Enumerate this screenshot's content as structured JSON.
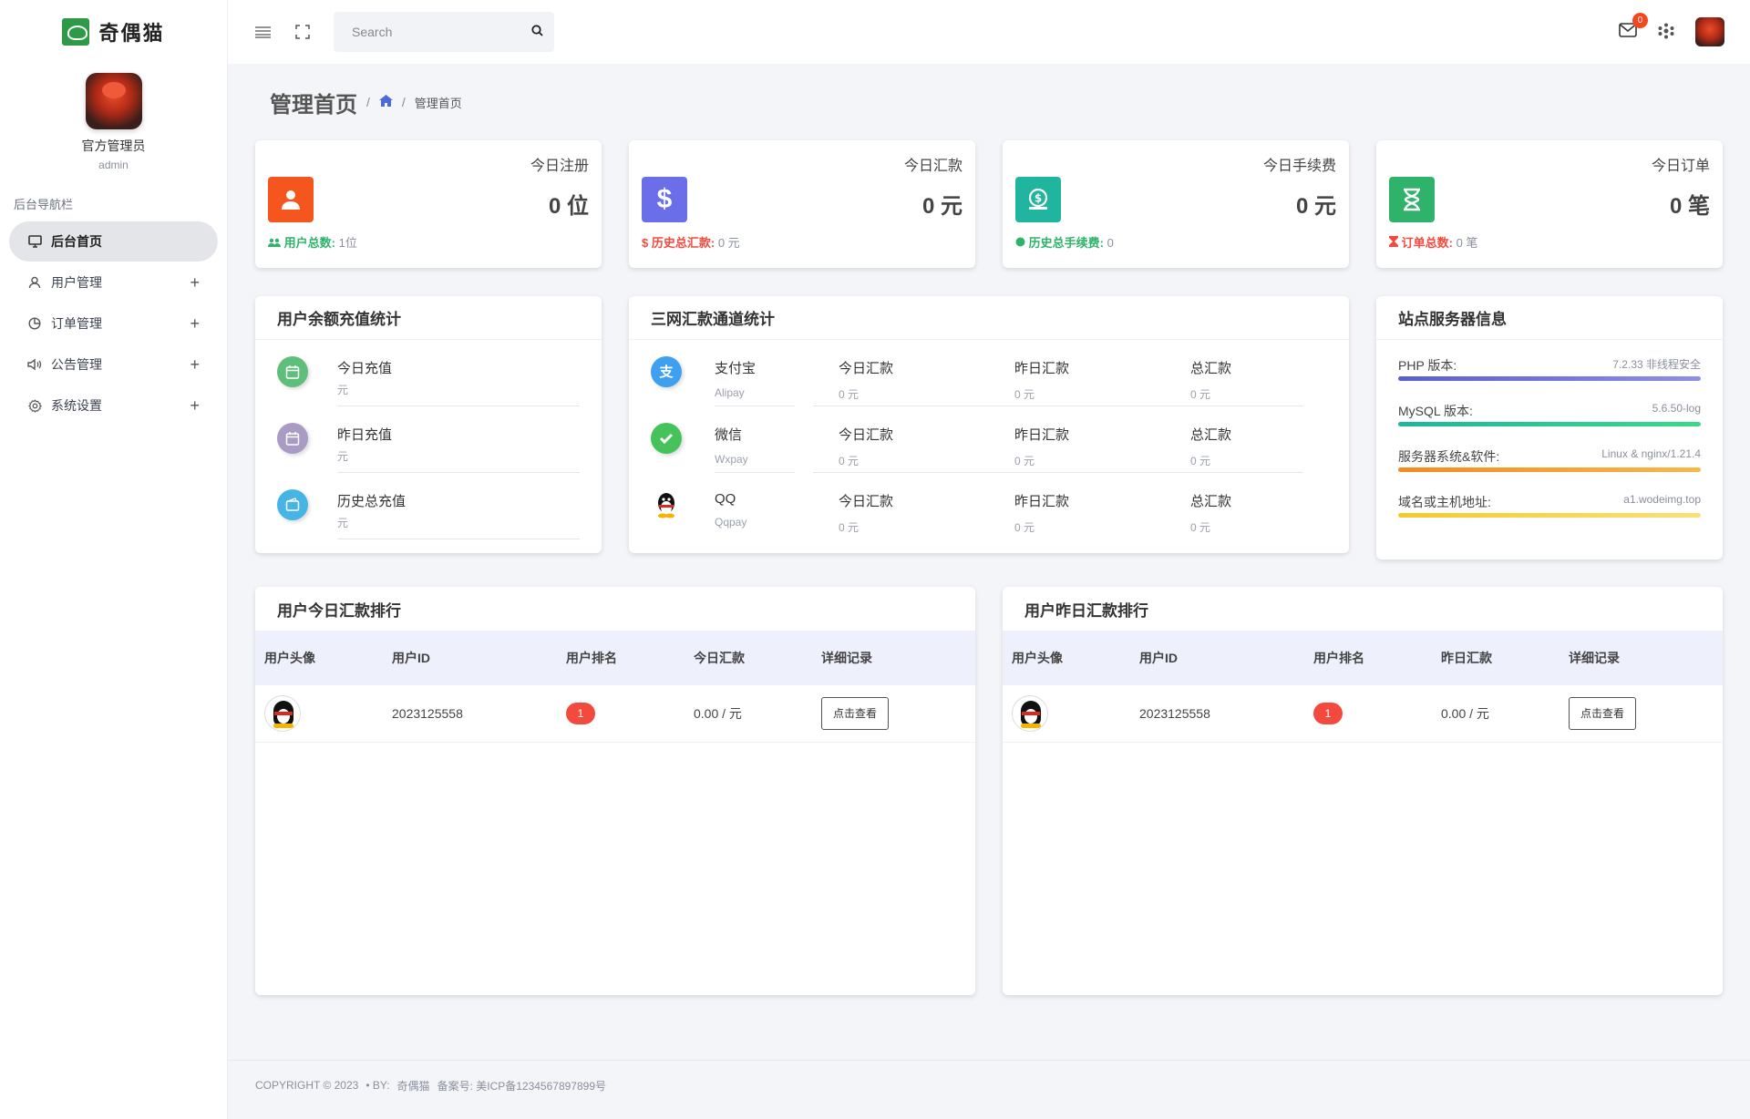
{
  "app": {
    "brand": "奇偶猫"
  },
  "profile": {
    "name": "官方管理员",
    "role": "admin"
  },
  "nav": {
    "title": "后台导航栏",
    "items": [
      {
        "label": "后台首页",
        "icon": "monitor-icon",
        "active": true
      },
      {
        "label": "用户管理",
        "icon": "user-icon"
      },
      {
        "label": "订单管理",
        "icon": "pie-chart-icon"
      },
      {
        "label": "公告管理",
        "icon": "speaker-icon"
      },
      {
        "label": "系统设置",
        "icon": "gear-icon"
      }
    ]
  },
  "topbar": {
    "search_placeholder": "Search",
    "mail_count": "0"
  },
  "page": {
    "title": "管理首页",
    "sep": "/",
    "crumb": "管理首页"
  },
  "stats": [
    {
      "title": "今日注册",
      "value": "0 位",
      "foot_label": "用户总数:",
      "foot_value": "1位",
      "color": "#f5561e",
      "foot_color": "#2fb36a",
      "icon": "user-icon"
    },
    {
      "title": "今日汇款",
      "value": "0 元",
      "foot_label": "历史总汇款:",
      "foot_value": "0 元",
      "color": "#6a6ee8",
      "foot_color": "#f44a3e",
      "icon": "dollar-icon"
    },
    {
      "title": "今日手续费",
      "value": "0 元",
      "foot_label": "历史总手续费:",
      "foot_value": "0",
      "color": "#1fb59e",
      "foot_color": "#2fb36a",
      "icon": "money-bag-icon"
    },
    {
      "title": "今日订单",
      "value": "0 笔",
      "foot_label": "订单总数:",
      "foot_value": "0 笔",
      "color": "#2fb36a",
      "foot_color": "#f44a3e",
      "icon": "hourglass-icon"
    }
  ],
  "recharge": {
    "title": "用户余额充值统计",
    "rows": [
      {
        "label": "今日充值",
        "unit": "元",
        "color": "#5fbf7a"
      },
      {
        "label": "昨日充值",
        "unit": "元",
        "color": "#a99bc3"
      },
      {
        "label": "历史总充值",
        "unit": "元",
        "color": "#46b5e5"
      }
    ]
  },
  "channels": {
    "title": "三网汇款通道统计",
    "rows": [
      {
        "name": "支付宝",
        "sub": "Alipay",
        "today": "今日汇款",
        "today_v": "0 元",
        "yest": "昨日汇款",
        "yest_v": "0 元",
        "total": "总汇款",
        "total_v": "0 元",
        "color": "#3ea0ef",
        "icon": "alipay-icon"
      },
      {
        "name": "微信",
        "sub": "Wxpay",
        "today": "今日汇款",
        "today_v": "0 元",
        "yest": "昨日汇款",
        "yest_v": "0 元",
        "total": "总汇款",
        "total_v": "0 元",
        "color": "#45c35a",
        "icon": "wechat-icon"
      },
      {
        "name": "QQ",
        "sub": "Qqpay",
        "today": "今日汇款",
        "today_v": "0 元",
        "yest": "昨日汇款",
        "yest_v": "0 元",
        "total": "总汇款",
        "total_v": "0 元",
        "color": "#ffffff",
        "icon": "qq-icon"
      }
    ]
  },
  "server": {
    "title": "站点服务器信息",
    "items": [
      {
        "key": "PHP 版本:",
        "value": "7.2.33 非线程安全",
        "color": "#6a6ee8"
      },
      {
        "key": "MySQL 版本:",
        "value": "5.6.50-log",
        "color": "#1fc49a"
      },
      {
        "key": "服务器系统&软件:",
        "value": "Linux & nginx/1.21.4",
        "color": "#f39a1e"
      },
      {
        "key": "域名或主机地址:",
        "value": "a1.wodeimg.top",
        "color": "#f6c928"
      }
    ]
  },
  "rank_today": {
    "title": "用户今日汇款排行",
    "headers": [
      "用户头像",
      "用户ID",
      "用户排名",
      "今日汇款",
      "详细记录"
    ],
    "rows": [
      {
        "id": "2023125558",
        "rank": "1",
        "amount": "0.00 / 元",
        "action": "点击查看"
      }
    ]
  },
  "rank_yesterday": {
    "title": "用户昨日汇款排行",
    "headers": [
      "用户头像",
      "用户ID",
      "用户排名",
      "昨日汇款",
      "详细记录"
    ],
    "rows": [
      {
        "id": "2023125558",
        "rank": "1",
        "amount": "0.00 / 元",
        "action": "点击查看"
      }
    ]
  },
  "footer": {
    "copyright": "COPYRIGHT © 2023",
    "by": "• BY:",
    "author": "奇偶猫",
    "icp": "备案号: 美ICP备1234567897899号"
  }
}
